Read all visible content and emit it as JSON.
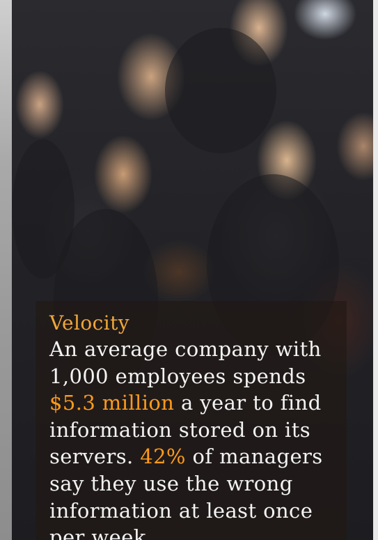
{
  "caption": {
    "title": "Velocity",
    "text_part1": "An average company with 1,000 employees spends ",
    "highlight1": "$5.3 million",
    "text_part2": " a year to find information stored on its servers. ",
    "highlight2": "42%",
    "text_part3": " of managers say they use the wrong information at least once per week."
  },
  "colors": {
    "title": "#f0a63a",
    "highlight": "#ff9a1a",
    "body_text": "#f3f3f3",
    "caption_background": "rgba(32,24,20,0.62)"
  },
  "photo": {
    "subject": "crowd-of-business-people-using-phones"
  }
}
